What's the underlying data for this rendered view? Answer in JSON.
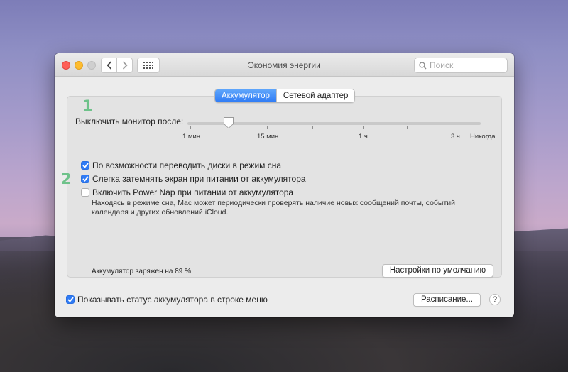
{
  "window": {
    "title": "Экономия энергии",
    "search_placeholder": "Поиск"
  },
  "tabs": [
    {
      "label": "Аккумулятор",
      "active": true
    },
    {
      "label": "Сетевой адаптер",
      "active": false
    }
  ],
  "annotations": {
    "one": "1",
    "two": "2",
    "color": "#6ec28a"
  },
  "display_sleep": {
    "label": "Выключить монитор после:",
    "ticks": [
      "1 мин",
      "15 мин",
      "1 ч",
      "3 ч",
      "Никогда"
    ]
  },
  "options": [
    {
      "label": "По возможности переводить диски в режим сна",
      "checked": true
    },
    {
      "label": "Слегка затемнять экран при питании от аккумулятора",
      "checked": true
    },
    {
      "label": "Включить Power Nap при питании от аккумулятора",
      "checked": false
    }
  ],
  "power_nap_description": "Находясь в режиме сна, Mac может периодически проверять наличие новых сообщений почты, событий календаря и других обновлений iCloud.",
  "battery_status": "Аккумулятор заряжен на 89 %",
  "buttons": {
    "restore_defaults": "Настройки по умолчанию",
    "schedule": "Расписание...",
    "help": "?"
  },
  "menu_bar_option": {
    "label": "Показывать статус аккумулятора в строке меню",
    "checked": true
  },
  "colors": {
    "accent": "#2f7bf5"
  }
}
